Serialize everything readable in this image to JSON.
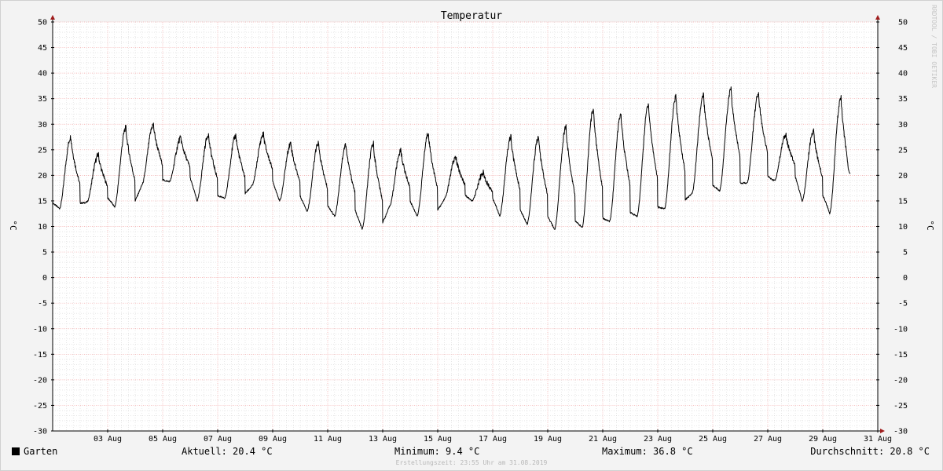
{
  "chart_data": {
    "type": "line",
    "title": "Temperatur",
    "ylabel": "°C",
    "ylim": [
      -30,
      50
    ],
    "y_ticks": [
      50,
      45,
      40,
      35,
      30,
      25,
      20,
      15,
      10,
      5,
      0,
      -5,
      -10,
      -15,
      -20,
      -25,
      -30
    ],
    "x_tick_labels": [
      "03 Aug",
      "05 Aug",
      "07 Aug",
      "09 Aug",
      "11 Aug",
      "13 Aug",
      "15 Aug",
      "17 Aug",
      "19 Aug",
      "21 Aug",
      "23 Aug",
      "25 Aug",
      "27 Aug",
      "29 Aug",
      "31 Aug"
    ],
    "x_range_days": [
      1.0,
      31.0
    ],
    "x_ticks_days": [
      3,
      5,
      7,
      9,
      11,
      13,
      15,
      17,
      19,
      21,
      23,
      25,
      27,
      29,
      31
    ],
    "grid": true,
    "series": [
      {
        "name": "Garten",
        "color": "#000000",
        "daily_min": [
          13.5,
          14.8,
          13.8,
          18.2,
          18.8,
          15.0,
          15.5,
          18.0,
          15.0,
          13.0,
          12.0,
          9.5,
          14.0,
          12.0,
          15.5,
          15.0,
          12.0,
          10.5,
          9.4,
          9.8,
          11.0,
          12.0,
          13.5,
          16.5,
          17.0,
          18.5,
          19.0,
          15.0,
          12.5
        ],
        "daily_max": [
          27.5,
          24.0,
          29.3,
          29.9,
          27.3,
          28.0,
          27.8,
          28.0,
          26.3,
          26.3,
          26.0,
          26.2,
          24.8,
          28.3,
          23.5,
          20.5,
          27.5,
          27.5,
          29.5,
          33.0,
          32.0,
          34.0,
          35.3,
          35.8,
          36.8,
          36.0,
          28.0,
          28.7,
          35.2
        ],
        "last_value": 20.4
      }
    ],
    "watermark": "RRDTOOL / TOBI OETIKER"
  },
  "legend": {
    "series_name": "Garten",
    "swatch_color": "#000000",
    "current": "Aktuell: 20.4 °C",
    "minimum": "Minimum: 9.4 °C",
    "maximum": "Maximum: 36.8 °C",
    "average": "Durchschnitt: 20.8 °C"
  },
  "footer": "Erstellungszeit: 23:55 Uhr am 31.08.2019",
  "colors": {
    "background": "#f3f3f3",
    "canvas": "#ffffff",
    "major_grid": "#f2a6a6",
    "minor_grid": "#d8d8d8",
    "axis_arrow": "#a01c1c"
  }
}
